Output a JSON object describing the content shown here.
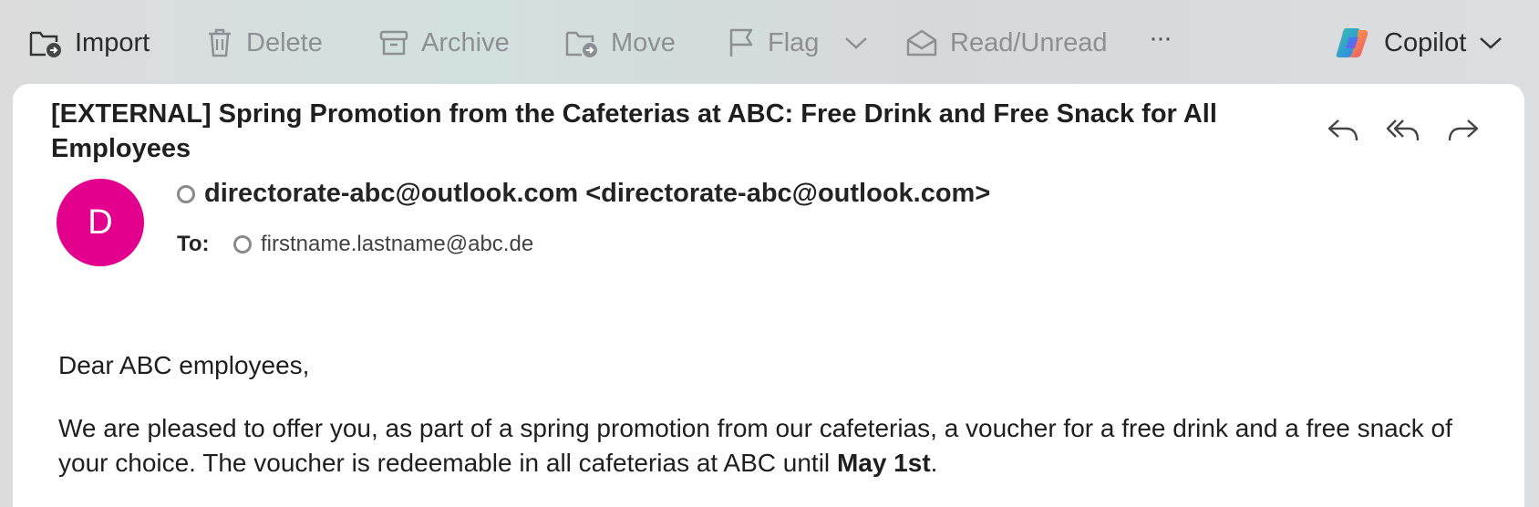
{
  "toolbar": {
    "import": "Import",
    "delete": "Delete",
    "archive": "Archive",
    "move": "Move",
    "flag": "Flag",
    "read_unread": "Read/Unread",
    "more": "···",
    "copilot": "Copilot"
  },
  "message": {
    "subject": "[EXTERNAL] Spring Promotion from the Cafeterias at ABC: Free Drink and Free Snack for All Employees",
    "avatar_initial": "D",
    "avatar_color": "#e3008c",
    "from": "directorate-abc@outlook.com <directorate-abc@outlook.com>",
    "to_label": "To:",
    "to": "firstname.lastname@abc.de"
  },
  "body": {
    "greeting": "Dear ABC employees,",
    "paragraph1_main": "We are pleased to offer you, as part of a spring promotion from our cafeterias, a voucher for a free drink and a free snack of your choice. The voucher is redeemable in all cafeterias at ABC until ",
    "paragraph1_date": "May 1st",
    "paragraph1_end": "."
  }
}
